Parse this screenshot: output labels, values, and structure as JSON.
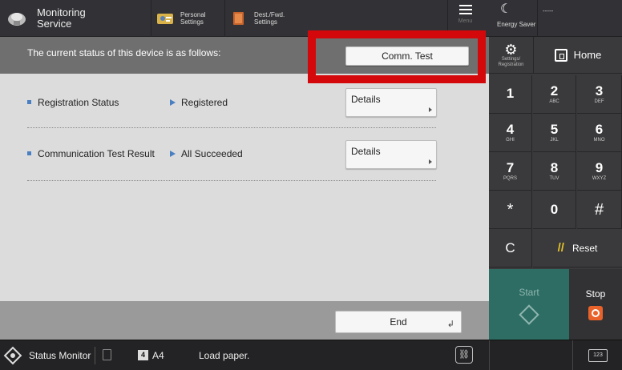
{
  "topbar": {
    "app_title": "Monitoring\nService",
    "personal_settings": "Personal\nSettings",
    "dest_fwd_settings": "Dest./Fwd.\nSettings",
    "menu_label": "Menu",
    "energy_saver": "Energy Saver",
    "user": "-----"
  },
  "main": {
    "header_text": "The current status of this device is as follows:",
    "comm_test_label": "Comm. Test",
    "rows": [
      {
        "label": "Registration Status",
        "value": "Registered",
        "details_label": "Details"
      },
      {
        "label": "Communication Test Result",
        "value": "All Succeeded",
        "details_label": "Details"
      }
    ],
    "end_label": "End",
    "highlight_color": "#d4080a"
  },
  "keypad": {
    "settings_label": "Settings/\nRegistration",
    "home_label": "Home",
    "keys": [
      {
        "num": "1",
        "sub": ""
      },
      {
        "num": "2",
        "sub": "ABC"
      },
      {
        "num": "3",
        "sub": "DEF"
      },
      {
        "num": "4",
        "sub": "GHI"
      },
      {
        "num": "5",
        "sub": "JKL"
      },
      {
        "num": "6",
        "sub": "MNO"
      },
      {
        "num": "7",
        "sub": "PQRS"
      },
      {
        "num": "8",
        "sub": "TUV"
      },
      {
        "num": "9",
        "sub": "WXYZ"
      },
      {
        "num": "*",
        "sub": ""
      },
      {
        "num": "0",
        "sub": ""
      },
      {
        "num": "#",
        "sub": ""
      }
    ],
    "clear_label": "C",
    "reset_label": "Reset",
    "start_label": "Start",
    "stop_label": "Stop",
    "start_color": "#2d6d64",
    "stop_color": "#e8622a"
  },
  "statusbar": {
    "status_monitor": "Status Monitor",
    "tray_number": "4",
    "paper_size": "A4",
    "message": "Load paper.",
    "keyboard_label": "123"
  }
}
